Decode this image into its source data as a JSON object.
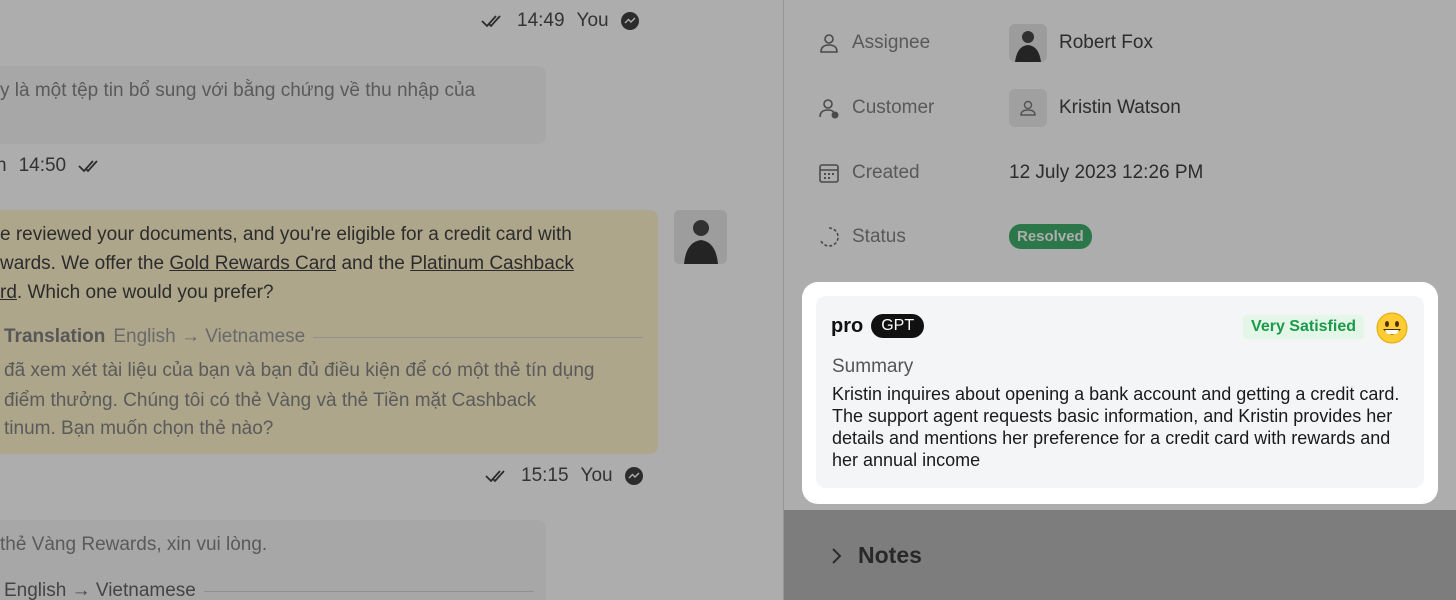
{
  "chat": {
    "meta_top": {
      "time": "14:49",
      "author": "You"
    },
    "msg1": {
      "line1": "y là một tệp tin bổ sung với bằng chứng về thu nhập của"
    },
    "meta_mid": {
      "author_partial": "n",
      "time": "14:50"
    },
    "msg2": {
      "line1": "e reviewed your documents, and you're eligible for a credit card with",
      "line2_a": "wards. We offer the ",
      "line2_link1": "Gold Rewards Card",
      "line2_b": " and the ",
      "line2_link2": "Platinum Cashback",
      "line3_link": "rd",
      "line3_rest": ". Which one would you prefer?",
      "translation_label": "Translation",
      "translation_lang": "English → Vietnamese",
      "tr_line1": "đã xem xét tài liệu của bạn và bạn đủ điều kiện để có một thẻ tín dụng",
      "tr_line2": "điểm thưởng. Chúng tôi có thẻ Vàng và thẻ Tiền mặt Cashback",
      "tr_line3": "tinum. Bạn muốn chọn thẻ nào?"
    },
    "meta_bottom": {
      "time": "15:15",
      "author": "You"
    },
    "msg3": {
      "line1": "thẻ Vàng Rewards, xin vui lòng.",
      "translation_lang": "English → Vietnamese"
    }
  },
  "details": {
    "assignee": {
      "label": "Assignee",
      "value": "Robert Fox"
    },
    "customer": {
      "label": "Customer",
      "value": "Kristin Watson"
    },
    "created": {
      "label": "Created",
      "value": "12 July 2023 12:26 PM"
    },
    "status": {
      "label": "Status",
      "value": "Resolved",
      "color": "#1fa253"
    }
  },
  "summary_card": {
    "brand_pro": "pro",
    "brand_gpt": "GPT",
    "sentiment": "Very Satisfied",
    "sentiment_icon": "grinning-face-emoji",
    "title": "Summary",
    "body": "Kristin inquires about opening a bank account and getting a credit card. The support agent requests basic information, and Kristin provides her details and mentions her preference for a credit card with rewards and her annual income"
  },
  "notes": {
    "label": "Notes"
  }
}
